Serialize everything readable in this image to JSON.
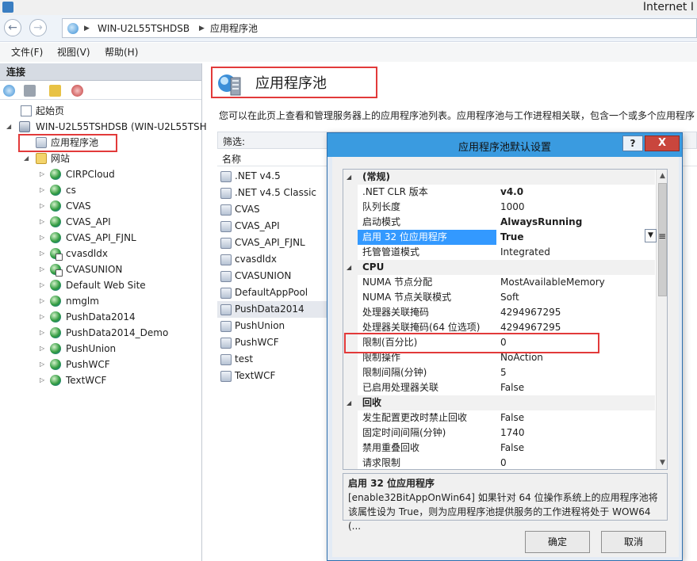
{
  "window": {
    "title": "Internet I"
  },
  "address": {
    "server": "WIN-U2L55TSHDSB",
    "page": "应用程序池"
  },
  "menu": [
    "文件(F)",
    "视图(V)",
    "帮助(H)"
  ],
  "left": {
    "header": "连接",
    "tree": {
      "start_page": "起始页",
      "server": "WIN-U2L55TSHDSB (WIN-U2L55TSH",
      "app_pools": "应用程序池",
      "sites_label": "网站",
      "sites": [
        "CIRPCloud",
        "cs",
        "CVAS",
        "CVAS_API",
        "CVAS_API_FJNL",
        "cvasdldx",
        "CVASUNION",
        "Default Web Site",
        "nmglm",
        "PushData2014",
        "PushData2014_Demo",
        "PushUnion",
        "PushWCF",
        "TextWCF"
      ]
    }
  },
  "main": {
    "title": "应用程序池",
    "description": "您可以在此页上查看和管理服务器上的应用程序池列表。应用程序池与工作进程相关联，包含一个或多个应用程序",
    "filter_label": "筛选:",
    "column_name": "名称",
    "pools": [
      ".NET v4.5",
      ".NET v4.5 Classic",
      "CVAS",
      "CVAS_API",
      "CVAS_API_FJNL",
      "cvasdldx",
      "CVASUNION",
      "DefaultAppPool",
      "PushData2014",
      "PushUnion",
      "PushWCF",
      "test",
      "TextWCF"
    ],
    "selected_pool": "PushData2014"
  },
  "dialog": {
    "title": "应用程序池默认设置",
    "help": "?",
    "close": "X",
    "categories": {
      "general": "(常规)",
      "cpu": "CPU",
      "recycling": "回收"
    },
    "general_props": [
      {
        "name": ".NET CLR 版本",
        "value": "v4.0",
        "bold": true
      },
      {
        "name": "队列长度",
        "value": "1000",
        "bold": false
      },
      {
        "name": "启动模式",
        "value": "AlwaysRunning",
        "bold": true
      },
      {
        "name": "启用 32 位应用程序",
        "value": "True",
        "bold": true
      },
      {
        "name": "托管管道模式",
        "value": "Integrated",
        "bold": false
      }
    ],
    "cpu_props": [
      {
        "name": "NUMA 节点分配",
        "value": "MostAvailableMemory"
      },
      {
        "name": "NUMA 节点关联模式",
        "value": "Soft"
      },
      {
        "name": "处理器关联掩码",
        "value": "4294967295"
      },
      {
        "name": "处理器关联掩码(64 位选项)",
        "value": "4294967295"
      },
      {
        "name": "限制(百分比)",
        "value": "0"
      },
      {
        "name": "限制操作",
        "value": "NoAction"
      },
      {
        "name": "限制间隔(分钟)",
        "value": "5"
      },
      {
        "name": "已启用处理器关联",
        "value": "False"
      }
    ],
    "recycling_props": [
      {
        "name": "发生配置更改时禁止回收",
        "value": "False"
      },
      {
        "name": "固定时间间隔(分钟)",
        "value": "1740"
      },
      {
        "name": "禁用重叠回收",
        "value": "False"
      },
      {
        "name": "请求限制",
        "value": "0"
      }
    ],
    "desc_title": "启用 32 位应用程序",
    "desc_text": "[enable32BitAppOnWin64] 如果针对 64 位操作系统上的应用程序池将该属性设为 True，则为应用程序池提供服务的工作进程将处于 WOW64 (...",
    "ok": "确定",
    "cancel": "取消"
  }
}
